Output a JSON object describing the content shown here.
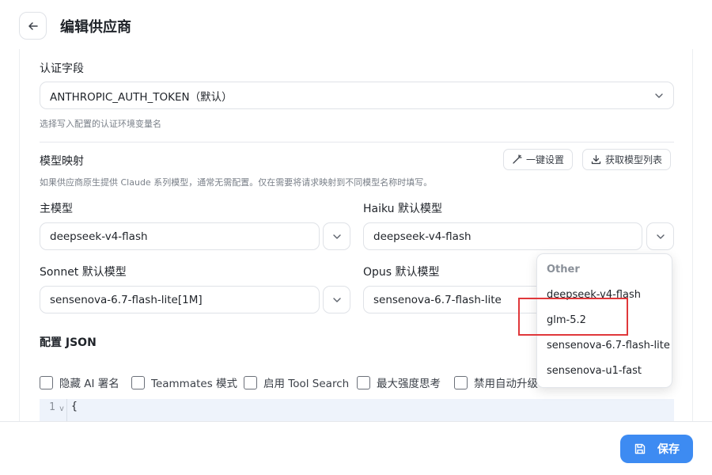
{
  "header": {
    "title": "编辑供应商"
  },
  "auth": {
    "label": "认证字段",
    "value": "ANTHROPIC_AUTH_TOKEN（默认）",
    "hint": "选择写入配置的认证环境变量名"
  },
  "mapping": {
    "label": "模型映射",
    "hint": "如果供应商原生提供 Claude 系列模型，通常无需配置。仅在需要将请求映射到不同模型名称时填写。",
    "one_click_label": "一键设置",
    "fetch_label": "获取模型列表",
    "main_label": "主模型",
    "main_value": "deepseek-v4-flash",
    "haiku_label": "Haiku 默认模型",
    "haiku_value": "deepseek-v4-flash",
    "sonnet_label": "Sonnet 默认模型",
    "sonnet_value": "sensenova-6.7-flash-lite[1M]",
    "opus_label": "Opus 默认模型",
    "opus_value": "sensenova-6.7-flash-lite"
  },
  "config": {
    "label": "配置 JSON",
    "checkboxes": [
      "隐藏 AI 署名",
      "Teammates 模式",
      "启用 Tool Search",
      "最大强度思考",
      "禁用自动升级"
    ],
    "line_number": "1",
    "fold_marker": "v",
    "first_line": "{"
  },
  "dropdown": {
    "group": "Other",
    "items": [
      "deepseek-v4-flash",
      "glm-5.2",
      "sensenova-6.7-flash-lite",
      "sensenova-u1-fast"
    ],
    "highlighted_item": "glm-5.2"
  },
  "footer": {
    "save_label": "保存"
  },
  "colors": {
    "accent": "#3d8bf2",
    "highlight_box": "#e0383b",
    "code_bg": "#eef3fb"
  },
  "icons": [
    "arrow-left-icon",
    "chevron-down-icon",
    "magic-wand-icon",
    "download-icon",
    "save-icon"
  ]
}
